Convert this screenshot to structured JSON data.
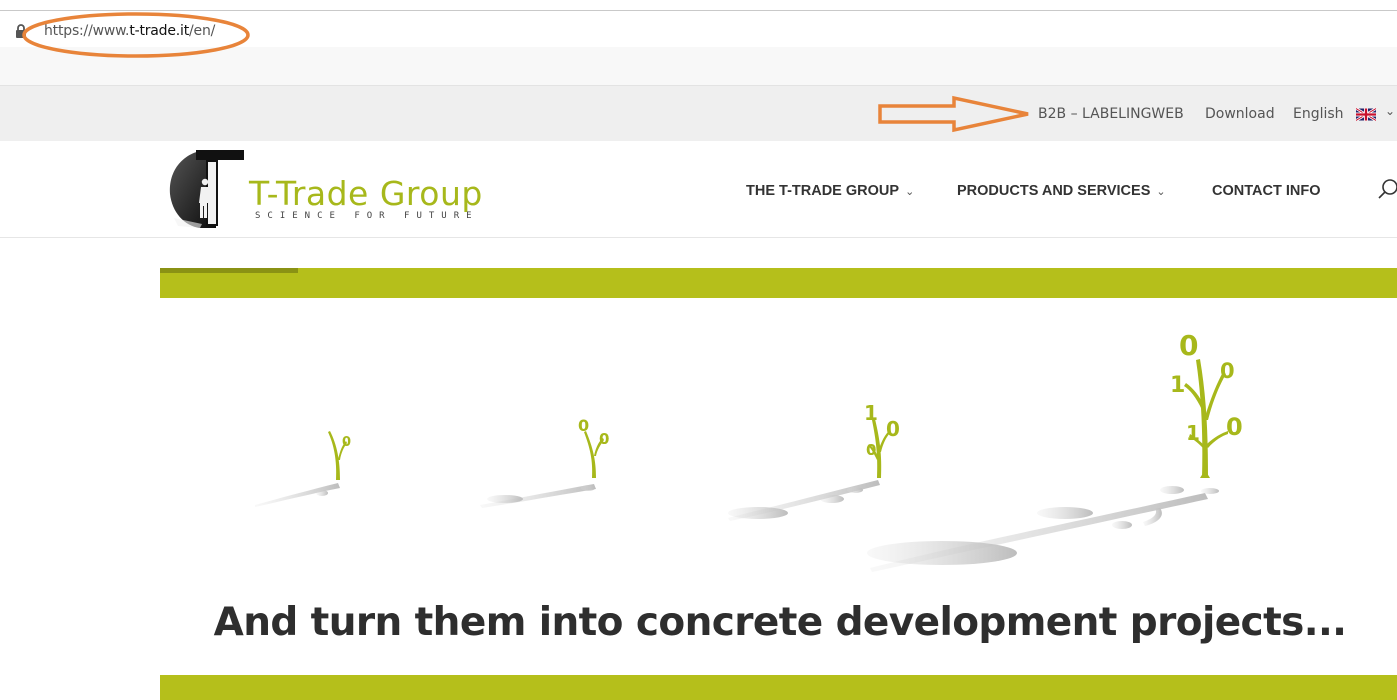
{
  "browser": {
    "url_prefix": "https://www.",
    "url_domain": "t-trade.it",
    "url_path": "/en/"
  },
  "topbar": {
    "b2b_label": "B2B – LABELINGWEB",
    "download_label": "Download",
    "language_label": "English"
  },
  "header": {
    "brand": "T-Trade Group",
    "tagline": "SCIENCE FOR FUTURE",
    "nav": [
      {
        "label": "THE T-TRADE GROUP"
      },
      {
        "label": "PRODUCTS AND SERVICES"
      },
      {
        "label": "CONTACT INFO"
      }
    ]
  },
  "hero": {
    "headline": "And turn them into concrete development projects...",
    "sprout_digits": [
      "0",
      "0",
      "0",
      "1",
      "0",
      "0",
      "0",
      "1",
      "0",
      "1",
      "0"
    ]
  },
  "colors": {
    "accent_green": "#b5bf1b",
    "annotation_orange": "#e8843a"
  },
  "icons": [
    "lock-icon",
    "uk-flag-icon",
    "chevron-down-icon",
    "search-icon"
  ]
}
